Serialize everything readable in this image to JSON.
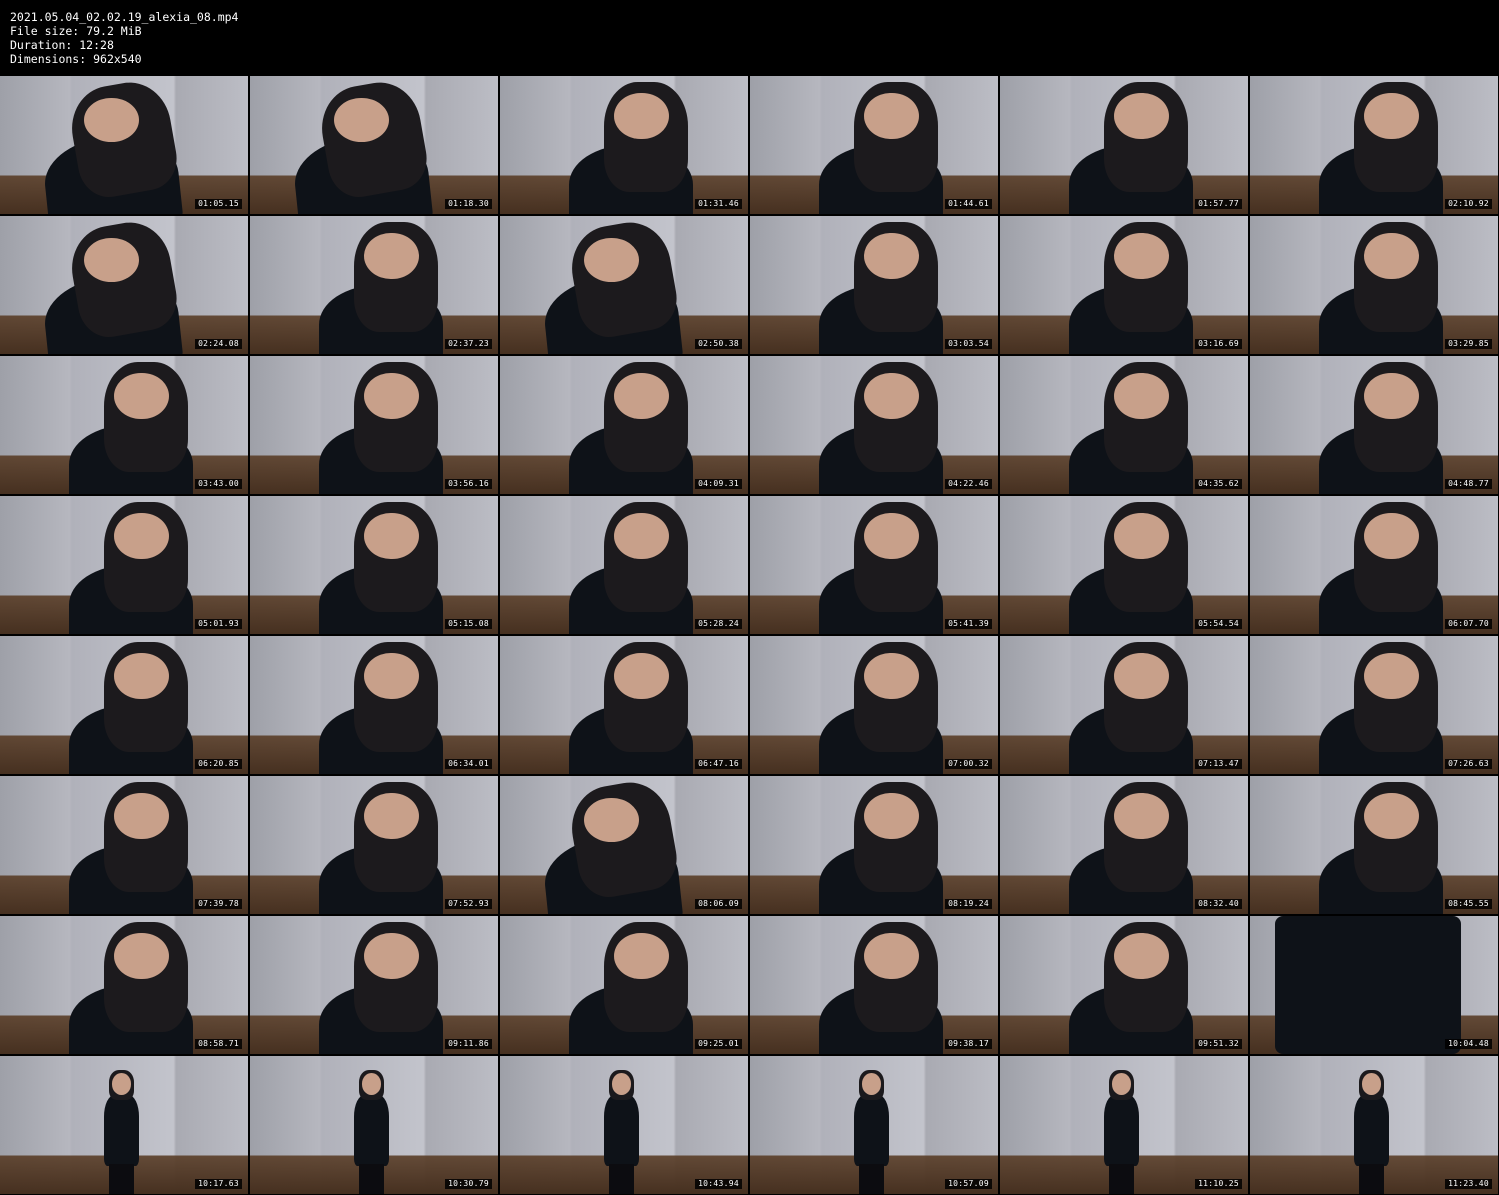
{
  "header": {
    "filename": "2021.05.04_02.02.19_alexia_08.mp4",
    "file_size_label": "File size:",
    "file_size": "79.2 MiB",
    "duration_label": "Duration:",
    "duration": "12:28",
    "dimensions_label": "Dimensions:",
    "dimensions": "962x540"
  },
  "thumbnails": [
    {
      "timestamp": "01:05.15",
      "style": "lean"
    },
    {
      "timestamp": "01:18.30",
      "style": "lean"
    },
    {
      "timestamp": "01:31.46",
      "style": "close"
    },
    {
      "timestamp": "01:44.61",
      "style": "close"
    },
    {
      "timestamp": "01:57.77",
      "style": "close"
    },
    {
      "timestamp": "02:10.92",
      "style": "close"
    },
    {
      "timestamp": "02:24.08",
      "style": "lean"
    },
    {
      "timestamp": "02:37.23",
      "style": "close"
    },
    {
      "timestamp": "02:50.38",
      "style": "lean"
    },
    {
      "timestamp": "03:03.54",
      "style": "close"
    },
    {
      "timestamp": "03:16.69",
      "style": "close"
    },
    {
      "timestamp": "03:29.85",
      "style": "close"
    },
    {
      "timestamp": "03:43.00",
      "style": "close"
    },
    {
      "timestamp": "03:56.16",
      "style": "close"
    },
    {
      "timestamp": "04:09.31",
      "style": "close"
    },
    {
      "timestamp": "04:22.46",
      "style": "close"
    },
    {
      "timestamp": "04:35.62",
      "style": "close"
    },
    {
      "timestamp": "04:48.77",
      "style": "close"
    },
    {
      "timestamp": "05:01.93",
      "style": "close"
    },
    {
      "timestamp": "05:15.08",
      "style": "close"
    },
    {
      "timestamp": "05:28.24",
      "style": "close"
    },
    {
      "timestamp": "05:41.39",
      "style": "close"
    },
    {
      "timestamp": "05:54.54",
      "style": "close"
    },
    {
      "timestamp": "06:07.70",
      "style": "close"
    },
    {
      "timestamp": "06:20.85",
      "style": "close"
    },
    {
      "timestamp": "06:34.01",
      "style": "close"
    },
    {
      "timestamp": "06:47.16",
      "style": "close"
    },
    {
      "timestamp": "07:00.32",
      "style": "close"
    },
    {
      "timestamp": "07:13.47",
      "style": "close"
    },
    {
      "timestamp": "07:26.63",
      "style": "close"
    },
    {
      "timestamp": "07:39.78",
      "style": "close"
    },
    {
      "timestamp": "07:52.93",
      "style": "close"
    },
    {
      "timestamp": "08:06.09",
      "style": "lean"
    },
    {
      "timestamp": "08:19.24",
      "style": "close"
    },
    {
      "timestamp": "08:32.40",
      "style": "close"
    },
    {
      "timestamp": "08:45.55",
      "style": "close"
    },
    {
      "timestamp": "08:58.71",
      "style": "close"
    },
    {
      "timestamp": "09:11.86",
      "style": "close"
    },
    {
      "timestamp": "09:25.01",
      "style": "close"
    },
    {
      "timestamp": "09:38.17",
      "style": "close"
    },
    {
      "timestamp": "09:51.32",
      "style": "close"
    },
    {
      "timestamp": "10:04.48",
      "style": "dress"
    },
    {
      "timestamp": "10:17.63",
      "style": "full"
    },
    {
      "timestamp": "10:30.79",
      "style": "full"
    },
    {
      "timestamp": "10:43.94",
      "style": "full"
    },
    {
      "timestamp": "10:57.09",
      "style": "full"
    },
    {
      "timestamp": "11:10.25",
      "style": "full"
    },
    {
      "timestamp": "11:23.40",
      "style": "full"
    }
  ]
}
